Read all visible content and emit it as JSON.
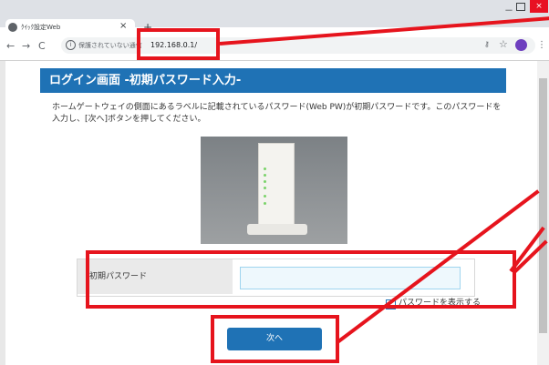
{
  "browser": {
    "tab_title": "ｸｲｯｸ設定Web",
    "tab_close": "×",
    "new_tab": "+",
    "back": "←",
    "forward": "→",
    "reload": "C",
    "info_icon": "i",
    "security_text": "保護されていない通信",
    "url": "192.168.0.1/",
    "win_min": "－",
    "win_close": "×",
    "menu": "⋮",
    "star": "☆",
    "key": "⚷"
  },
  "page": {
    "header_title": "ログイン画面 -初期パスワード入力-",
    "description": "ホームゲートウェイの側面にあるラベルに記載されているパスワード(Web PW)が初期パスワードです。このパスワードを入力し、[次へ]ボタンを押してください。",
    "password_label": "初期パスワード",
    "password_value": "",
    "show_password_label": "パスワードを表示する",
    "next_button": "次へ"
  },
  "colors": {
    "accent": "#1f72b5",
    "annotation_red": "#e6141d"
  }
}
